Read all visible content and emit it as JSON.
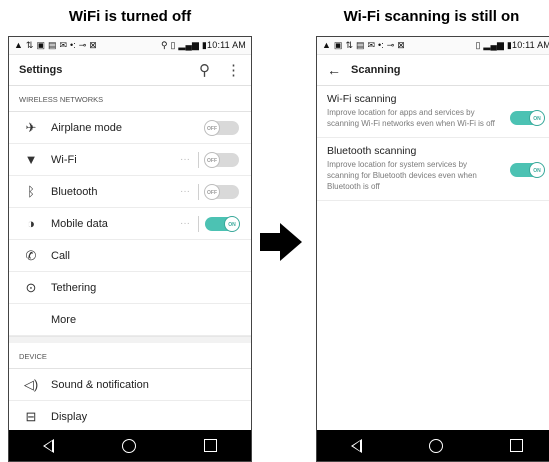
{
  "captions": {
    "left": "WiFi is turned off",
    "right": "Wi-Fi scanning is still on"
  },
  "status_bar": {
    "left_icons": [
      "warning-icon",
      "antenna-icon",
      "image-icon",
      "message-icon",
      "mail-icon",
      "usb-icon",
      "key-icon",
      "share-icon"
    ],
    "left_time": "10:11 AM",
    "right_time": "10:11 AM"
  },
  "settings_screen": {
    "title": "Settings",
    "sections": [
      {
        "header": "WIRELESS NETWORKS",
        "items": [
          {
            "label": "Airplane mode",
            "icon": "airplane-icon",
            "toggle": "OFF"
          },
          {
            "label": "Wi-Fi",
            "icon": "wifi-icon",
            "toggle": "OFF"
          },
          {
            "label": "Bluetooth",
            "icon": "bluetooth-icon",
            "toggle": "OFF"
          },
          {
            "label": "Mobile data",
            "icon": "mobile-data-icon",
            "toggle": "ON"
          },
          {
            "label": "Call",
            "icon": "phone-icon"
          },
          {
            "label": "Tethering",
            "icon": "tethering-icon"
          },
          {
            "label": "More"
          }
        ]
      },
      {
        "header": "DEVICE",
        "items": [
          {
            "label": "Sound & notification",
            "icon": "speaker-icon"
          },
          {
            "label": "Display",
            "icon": "display-icon"
          }
        ]
      }
    ]
  },
  "scanning_screen": {
    "title": "Scanning",
    "items": [
      {
        "title": "Wi-Fi scanning",
        "description": "Improve location for apps and services by scanning Wi-Fi networks even when Wi-Fi is off",
        "toggle": "ON"
      },
      {
        "title": "Bluetooth scanning",
        "description": "Improve location for system services by scanning for Bluetooth devices even when Bluetooth is off",
        "toggle": "ON"
      }
    ]
  },
  "colors": {
    "toggle_on": "#4cc2b3",
    "toggle_off": "#d9d9d9",
    "navbar": "#000000"
  }
}
